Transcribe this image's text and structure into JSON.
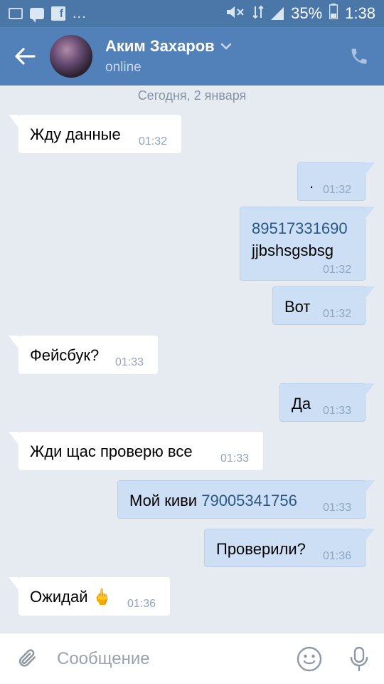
{
  "status_bar": {
    "battery": "35%",
    "time": "1:38",
    "more": "..."
  },
  "header": {
    "contact_name": "Аким Захаров",
    "contact_status": "online"
  },
  "chat": {
    "date_separator": "Сегодня, 2 января",
    "messages": [
      {
        "direction": "in",
        "text": "Жду данные",
        "time": "01:32"
      },
      {
        "direction": "out",
        "text": ".",
        "time": "01:32"
      },
      {
        "direction": "out",
        "text_link": "89517331690",
        "text_line2": "jjbshsgsbsg",
        "time": "01:32"
      },
      {
        "direction": "out",
        "text": "Вот",
        "time": "01:32"
      },
      {
        "direction": "in",
        "text": "Фейсбук?",
        "time": "01:33"
      },
      {
        "direction": "out",
        "text": "Да",
        "time": "01:33"
      },
      {
        "direction": "in",
        "text": "Жди щас проверю все",
        "time": "01:33"
      },
      {
        "direction": "out",
        "text_prefix": "Мой киви ",
        "text_link": "79005341756",
        "time": "01:33"
      },
      {
        "direction": "out",
        "text": "Проверили?",
        "time": "01:36"
      },
      {
        "direction": "in",
        "text": "Ожидай",
        "emoji": "🖕",
        "time": "01:36"
      }
    ]
  },
  "input": {
    "placeholder": "Сообщение"
  },
  "colors": {
    "header": "#5181b8",
    "status_bar": "#4a76a8",
    "chat_bg": "#e6ebf1",
    "bubble_in": "#ffffff",
    "bubble_out": "#ccdff5",
    "link": "#2a5885"
  },
  "icons": [
    "back-arrow-icon",
    "chevron-down-icon",
    "phone-icon",
    "paperclip-icon",
    "smiley-icon",
    "microphone-icon"
  ]
}
